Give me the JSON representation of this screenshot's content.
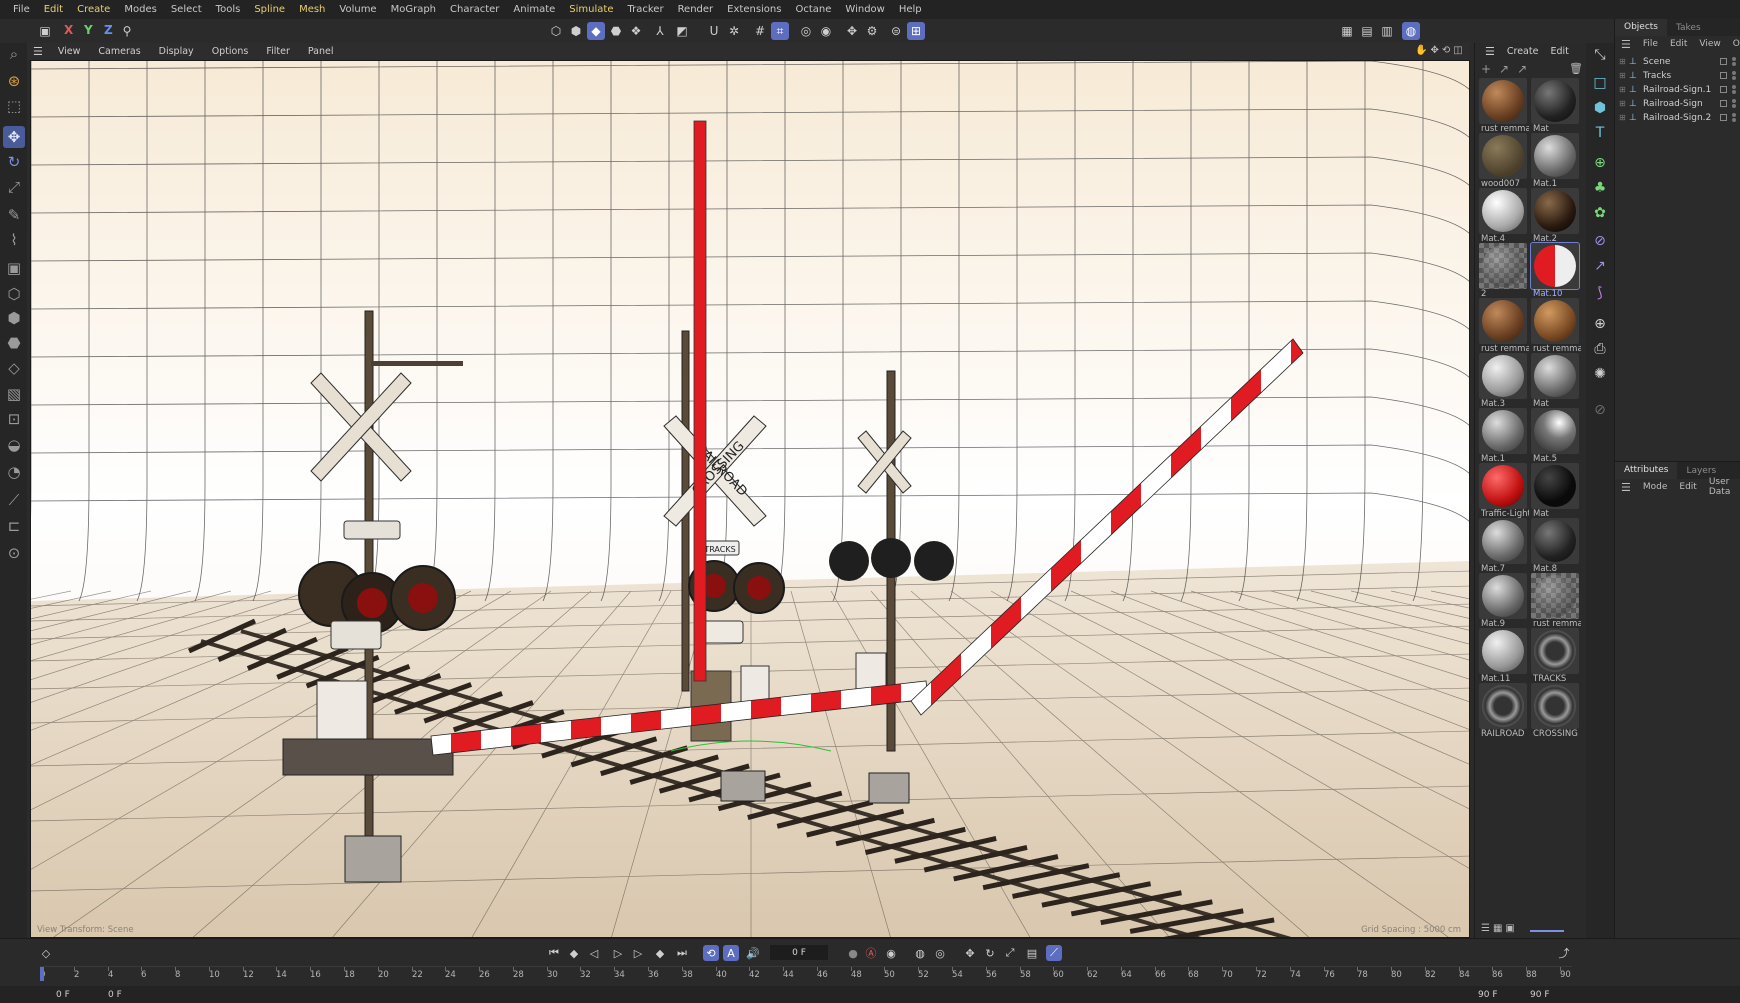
{
  "menu": [
    "File",
    "Edit",
    "Create",
    "Modes",
    "Select",
    "Tools",
    "Spline",
    "Mesh",
    "Volume",
    "MoGraph",
    "Character",
    "Animate",
    "Simulate",
    "Tracker",
    "Render",
    "Extensions",
    "Octane",
    "Window",
    "Help"
  ],
  "menu_highlight": [
    "Edit",
    "Create",
    "Spline",
    "Mesh",
    "Simulate"
  ],
  "axes": {
    "x": "X",
    "y": "Y",
    "z": "Z"
  },
  "viewport_menu": [
    "View",
    "Cameras",
    "Display",
    "Options",
    "Filter",
    "Panel"
  ],
  "viewport": {
    "view_transform": "View Transform: Scene",
    "grid_spacing": "Grid Spacing : 5000 cm"
  },
  "crossing_sign": {
    "top": "CROSSING",
    "bottom": "RAILROAD",
    "tracks": "TRACKS"
  },
  "materials_menu": [
    "Create",
    "Edit"
  ],
  "materials": [
    {
      "name": "rust remma",
      "type": "rust"
    },
    {
      "name": "Mat",
      "type": "dark"
    },
    {
      "name": "wood007",
      "type": "wood"
    },
    {
      "name": "Mat.1",
      "type": "grey"
    },
    {
      "name": "Mat.4",
      "type": "white"
    },
    {
      "name": "Mat.2",
      "type": "darkdots"
    },
    {
      "name": "2",
      "type": "checker"
    },
    {
      "name": "Mat.10",
      "type": "redwhite"
    },
    {
      "name": "rust remma",
      "type": "rust"
    },
    {
      "name": "rust remma",
      "type": "rust2"
    },
    {
      "name": "Mat.3",
      "type": "lightgrey"
    },
    {
      "name": "Mat",
      "type": "grey"
    },
    {
      "name": "Mat.1",
      "type": "grey"
    },
    {
      "name": "Mat.5",
      "type": "metal"
    },
    {
      "name": "Traffic-Light",
      "type": "redlight"
    },
    {
      "name": "Mat",
      "type": "black"
    },
    {
      "name": "Mat.7",
      "type": "grey"
    },
    {
      "name": "Mat.8",
      "type": "dark"
    },
    {
      "name": "Mat.9",
      "type": "grey"
    },
    {
      "name": "rust remma",
      "type": "checker"
    },
    {
      "name": "Mat.11",
      "type": "lightgrey"
    },
    {
      "name": "TRACKS",
      "type": "ring"
    },
    {
      "name": "RAILROAD",
      "type": "ring"
    },
    {
      "name": "CROSSING",
      "type": "ring"
    }
  ],
  "selected_material_index": 7,
  "objects_tabs": [
    "Objects",
    "Takes"
  ],
  "objects_menu": [
    "File",
    "Edit",
    "View",
    "Object"
  ],
  "objects": [
    "Scene",
    "Tracks",
    "Railroad-Sign.1",
    "Railroad-Sign",
    "Railroad-Sign.2"
  ],
  "attributes_tabs": [
    "Attributes",
    "Layers"
  ],
  "attributes_menu": [
    "Mode",
    "Edit",
    "User Data"
  ],
  "timeline": {
    "current_frame": "0 F",
    "start_frame": "0 F",
    "start_frame_2": "0 F",
    "end_frame": "90 F",
    "end_frame_2": "90 F",
    "ruler_ticks": [
      "0",
      "2",
      "4",
      "6",
      "8",
      "10",
      "12",
      "14",
      "16",
      "18",
      "20",
      "22",
      "24",
      "26",
      "28",
      "30",
      "32",
      "34",
      "36",
      "38",
      "40",
      "42",
      "44",
      "46",
      "48",
      "50",
      "52",
      "54",
      "56",
      "58",
      "60",
      "62",
      "64",
      "66",
      "68",
      "70",
      "72",
      "74",
      "76",
      "78",
      "80",
      "82",
      "84",
      "86",
      "88",
      "90"
    ]
  },
  "colors": {
    "accent": "#5d6ec0",
    "highlight_menu": "#e8cf6e",
    "barrier_red": "#e01b22",
    "viewport_bg": "#f4ead9"
  }
}
